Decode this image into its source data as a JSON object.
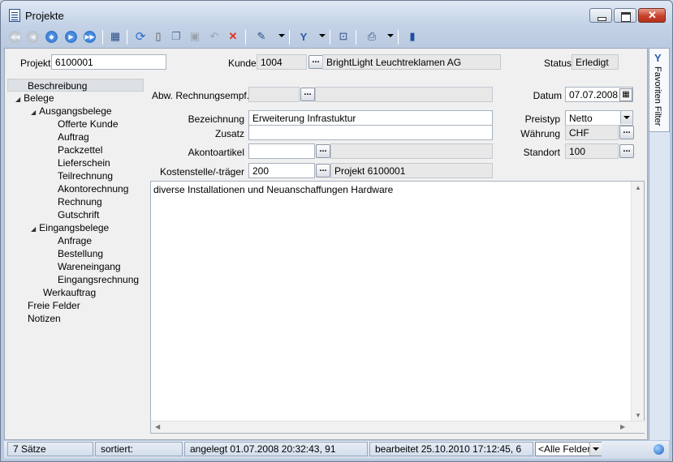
{
  "window": {
    "title": "Projekte"
  },
  "toolbar": {
    "icons": [
      "first-record-icon",
      "previous-record-icon",
      "next-page-icon",
      "next-record-icon",
      "last-record-icon",
      "table-view-icon",
      "refresh-icon",
      "new-document-icon",
      "copy-icon",
      "save-icon",
      "undo-icon",
      "delete-icon",
      "tools-icon",
      "filter-icon",
      "details-icon",
      "print-icon",
      "notebook-icon"
    ]
  },
  "header": {
    "projekt_label": "Projekt",
    "projekt_value": "6100001",
    "kunde_label": "Kunde",
    "kunde_value": "1004",
    "kunde_name": "BrightLight Leuchtreklamen AG",
    "status_label": "Status",
    "status_value": "Erledigt"
  },
  "tree": {
    "items": [
      {
        "label": "Beschreibung"
      },
      {
        "label": "Belege"
      },
      {
        "label": "Ausgangsbelege"
      },
      {
        "label": "Offerte Kunde"
      },
      {
        "label": "Auftrag"
      },
      {
        "label": "Packzettel"
      },
      {
        "label": "Lieferschein"
      },
      {
        "label": "Teilrechnung"
      },
      {
        "label": "Akontorechnung"
      },
      {
        "label": "Rechnung"
      },
      {
        "label": "Gutschrift"
      },
      {
        "label": "Eingangsbelege"
      },
      {
        "label": "Anfrage"
      },
      {
        "label": "Bestellung"
      },
      {
        "label": "Wareneingang"
      },
      {
        "label": "Eingangsrechnung"
      },
      {
        "label": "Werkauftrag"
      },
      {
        "label": "Freie Felder"
      },
      {
        "label": "Notizen"
      }
    ]
  },
  "form": {
    "abw_label": "Abw. Rechnungsempf.",
    "abw_value": "",
    "abw_name": "",
    "bezeichnung_label": "Bezeichnung",
    "bezeichnung_value": "Erweiterung Infrastuktur",
    "zusatz_label": "Zusatz",
    "zusatz_value": "",
    "akonto_label": "Akontoartikel",
    "akonto_value": "",
    "akonto_name": "",
    "kosten_label": "Kostenstelle/-träger",
    "kosten_value": "200",
    "kosten_name": "Projekt 6100001",
    "datum_label": "Datum",
    "datum_value": "07.07.2008",
    "preistyp_label": "Preistyp",
    "preistyp_value": "Netto",
    "waehrung_label": "Währung",
    "waehrung_value": "CHF",
    "standort_label": "Standort",
    "standort_value": "100"
  },
  "memo": {
    "text": "diverse Installationen und Neuanschaffungen Hardware"
  },
  "sidepanel": {
    "label": "Favoriten Filter"
  },
  "statusbar": {
    "count": "7 Sätze",
    "sorted": "sortiert:",
    "created": "angelegt 01.07.2008 20:32:43, 91",
    "edited": "bearbeitet 25.10.2010 17:12:45,  6",
    "fields": "<Alle Felder>"
  }
}
